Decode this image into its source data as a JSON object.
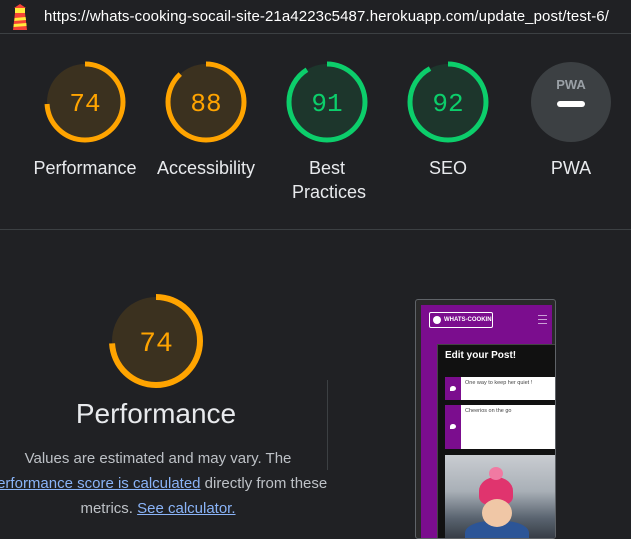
{
  "browser": {
    "url": "https://whats-cooking-socail-site-21a4223c5487.herokuapp.com/update_post/test-6/",
    "logo_icon": "lighthouse-icon"
  },
  "categories": [
    {
      "label": "Performance",
      "score": "74",
      "color": "#ffa400",
      "fraction": 0.74
    },
    {
      "label": "Accessibility",
      "score": "88",
      "color": "#ffa400",
      "fraction": 0.88
    },
    {
      "label": "Best Practices",
      "score": "91",
      "color": "#0cce6b",
      "fraction": 0.91
    },
    {
      "label": "SEO",
      "score": "92",
      "color": "#0cce6b",
      "fraction": 0.92
    },
    {
      "label": "PWA",
      "score": "PWA",
      "color": "#9aa0a6"
    }
  ],
  "performance": {
    "score": "74",
    "fraction": 0.74,
    "title": "Performance",
    "desc_before": "Values are estimated and may vary. The ",
    "desc_link": "performance score is calculated",
    "desc_middle": " directly from these metrics. ",
    "calculator_link": "See calculator."
  },
  "preview": {
    "logo_text": "WHATS-COOKIN",
    "heading": "Edit your Post!",
    "field1": "One way to keep her quiet !",
    "field2": "Cheerios on the go"
  },
  "colors": {
    "average": "#ffa400",
    "pass": "#0cce6b",
    "accent_purple": "#7b0d8e"
  }
}
